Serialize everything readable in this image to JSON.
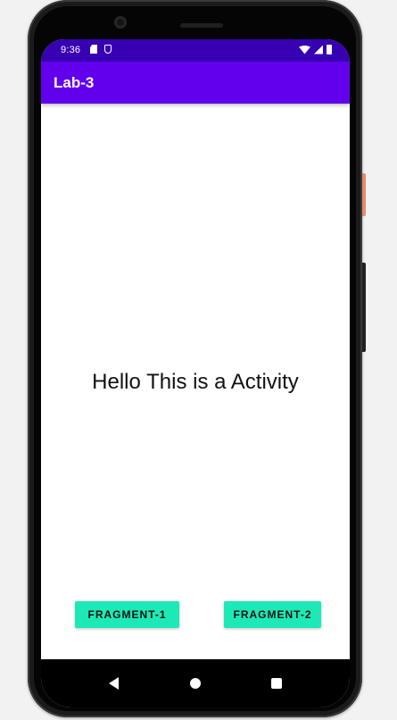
{
  "status_bar": {
    "time": "9:36",
    "left_icons": [
      "sd-card-icon",
      "shield-icon"
    ],
    "right_icons": [
      "wifi-icon",
      "signal-icon",
      "battery-icon"
    ],
    "background": "#3700b3"
  },
  "app_bar": {
    "title": "Lab-3",
    "background": "#6200ee"
  },
  "content": {
    "message": "Hello This is a Activity"
  },
  "buttons": {
    "fragment1_label": "FRAGMENT-1",
    "fragment2_label": "FRAGMENT-2",
    "color": "#1de9b6"
  },
  "nav_bar": {
    "icons": [
      "back-icon",
      "home-icon",
      "recents-icon"
    ]
  }
}
